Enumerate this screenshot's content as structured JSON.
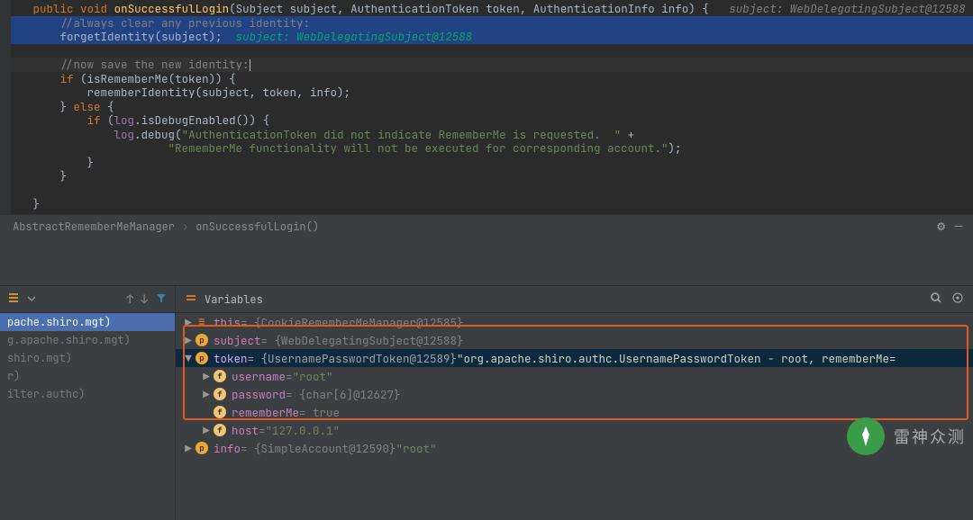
{
  "code": {
    "sig_public": "public",
    "sig_void": "void",
    "sig_method": "onSuccessfulLogin",
    "sig_p1t": "Subject",
    "sig_p1n": "subject",
    "sig_p2t": "AuthenticationToken",
    "sig_p2n": "token",
    "sig_p3t": "AuthenticationInfo",
    "sig_p3n": "info",
    "sig_inlay_right": "subject: WebDelegatingSubject@12588",
    "c1": "//always clear any previous identity:",
    "l2_call": "forgetIdentity",
    "l2_arg": "subject",
    "l2_inlay": "subject: WebDelegatingSubject@12588",
    "c2": "//now save the new identity:",
    "kw_if": "if",
    "cond1": "isRememberMe",
    "cond1_arg": "token",
    "call_remember": "rememberIdentity",
    "call_remember_args": "(subject, token, info)",
    "kw_else": "else",
    "obj_log": "log",
    "cond2": ".isDebugEnabled()",
    "call_debug": ".debug",
    "str1": "\"AuthenticationToken did not indicate RememberMe is requested.  \"",
    "plus": " +",
    "str2": "\"RememberMe functionality will not be executed for corresponding account.\""
  },
  "breadcrumb": {
    "a": "AbstractRememberMeManager",
    "b": "onSuccessfulLogin()"
  },
  "variables": {
    "title": "Variables",
    "rows": {
      "this_name": "this",
      "this_val": " = {CookieRememberMeManager@12585}",
      "subject_name": "subject",
      "subject_val": " = {WebDelegatingSubject@12588}",
      "token_name": "token",
      "token_val1": " = {UsernamePasswordToken@12589} ",
      "token_val_str": "\"org.apache.shiro.authc.UsernamePasswordToken - root, rememberMe=",
      "username_name": "username",
      "username_val": " = ",
      "username_str": "\"root\"",
      "password_name": "password",
      "password_val": " = {char[6]@12627}",
      "remember_name": "rememberMe",
      "remember_val": " = true",
      "host_name": "host",
      "host_val": " = ",
      "host_str": "\"127.0.0.1\"",
      "info_name": "info",
      "info_val": " = {SimpleAccount@12590} ",
      "info_str": "\"root\""
    }
  },
  "frames": {
    "f1": "pache.shiro.mgt)",
    "f2": "g.apache.shiro.mgt)",
    "f3": "shiro.mgt)",
    "f4": "r)",
    "f5": "ilter.authc)"
  },
  "watermark": "雷神众测"
}
